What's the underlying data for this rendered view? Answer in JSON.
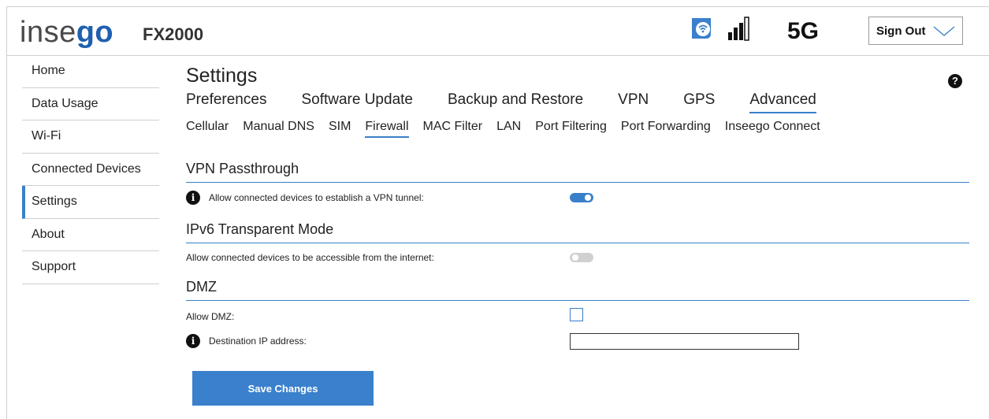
{
  "header": {
    "brand_pre": "inse",
    "brand_go": "go",
    "brand_post": "",
    "brand_start": "inseego",
    "model": "FX2000",
    "network": "5G",
    "signout_label": "Sign Out"
  },
  "sidebar": {
    "items": [
      {
        "label": "Home"
      },
      {
        "label": "Data Usage"
      },
      {
        "label": "Wi-Fi"
      },
      {
        "label": "Connected Devices"
      },
      {
        "label": "Settings"
      },
      {
        "label": "About"
      },
      {
        "label": "Support"
      }
    ],
    "active": "Settings"
  },
  "main": {
    "title": "Settings",
    "help_glyph": "?",
    "tabs": [
      {
        "label": "Preferences"
      },
      {
        "label": "Software Update"
      },
      {
        "label": "Backup and Restore"
      },
      {
        "label": "VPN"
      },
      {
        "label": "GPS"
      },
      {
        "label": "Advanced"
      }
    ],
    "active_tab": "Advanced",
    "subtabs": [
      {
        "label": "Cellular"
      },
      {
        "label": "Manual DNS"
      },
      {
        "label": "SIM"
      },
      {
        "label": "Firewall"
      },
      {
        "label": "MAC Filter"
      },
      {
        "label": "LAN"
      },
      {
        "label": "Port Filtering"
      },
      {
        "label": "Port Forwarding"
      },
      {
        "label": "Inseego Connect"
      }
    ],
    "active_subtab": "Firewall",
    "sections": {
      "vpn": {
        "title": "VPN Passthrough",
        "label": "Allow connected devices to establish a VPN tunnel:",
        "enabled": true
      },
      "ipv6": {
        "title": "IPv6 Transparent Mode",
        "label": "Allow connected devices to be accessible from the internet:",
        "enabled": false
      },
      "dmz": {
        "title": "DMZ",
        "allow_label": "Allow DMZ:",
        "allow_checked": false,
        "ip_label": "Destination IP address:",
        "ip_value": ""
      }
    },
    "info_glyph": "i",
    "save_label": "Save Changes"
  },
  "colors": {
    "accent": "#3a7fc9",
    "brand_blue": "#1e5fb0",
    "button": "#3a80cc"
  }
}
